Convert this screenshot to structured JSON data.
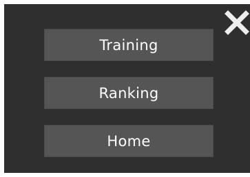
{
  "menu": {
    "buttons": [
      {
        "label": "Training"
      },
      {
        "label": "Ranking"
      },
      {
        "label": "Home"
      }
    ]
  },
  "close": {
    "icon": "close-icon",
    "color": "#eeeeee"
  },
  "colors": {
    "panel": "#2f2f2f",
    "button": "#555555",
    "text": "#ffffff"
  }
}
